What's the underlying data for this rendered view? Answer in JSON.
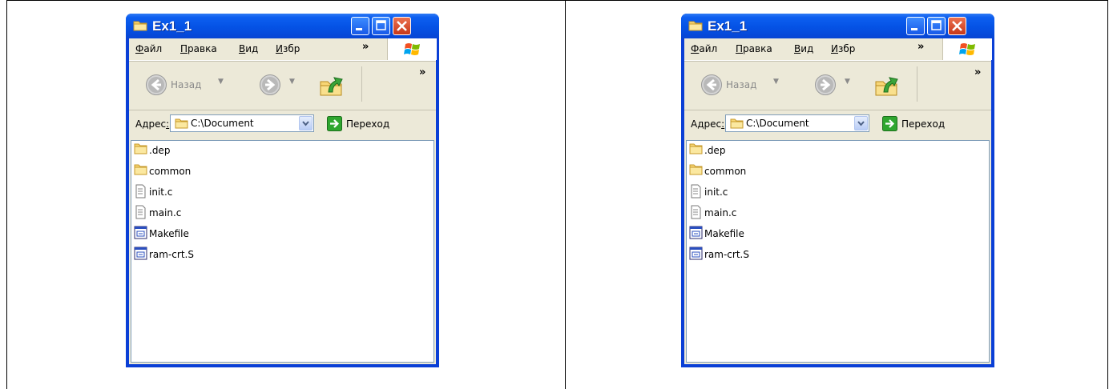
{
  "windows": [
    {
      "title": "Ex1_1",
      "menu": [
        {
          "label": "Файл",
          "accel": "Ф",
          "rest": "айл"
        },
        {
          "label": "Правка",
          "accel": "П",
          "rest": "равка"
        },
        {
          "label": "Вид",
          "accel": "В",
          "rest": "ид"
        },
        {
          "label": "Избр",
          "accel": "И",
          "rest": "збр"
        }
      ],
      "menu_overflow": "»",
      "toolbar": {
        "back_label": "Назад",
        "overflow": "»"
      },
      "address": {
        "label_main": "Адрес",
        "label_accel": ":",
        "value": "C:\\Document",
        "go_label": "Переход"
      },
      "files": [
        {
          "name": ".dep",
          "icon": "folder-icon"
        },
        {
          "name": "common",
          "icon": "folder-icon"
        },
        {
          "name": "init.c",
          "icon": "text-file-icon"
        },
        {
          "name": "main.c",
          "icon": "text-file-icon"
        },
        {
          "name": "Makefile",
          "icon": "app-file-icon"
        },
        {
          "name": "ram-crt.S",
          "icon": "app-file-icon"
        }
      ]
    },
    {
      "title": "Ex1_1",
      "menu": [
        {
          "label": "Файл",
          "accel": "Ф",
          "rest": "айл"
        },
        {
          "label": "Правка",
          "accel": "П",
          "rest": "равка"
        },
        {
          "label": "Вид",
          "accel": "В",
          "rest": "ид"
        },
        {
          "label": "Избр",
          "accel": "И",
          "rest": "збр"
        }
      ],
      "menu_overflow": "»",
      "toolbar": {
        "back_label": "Назад",
        "overflow": "»"
      },
      "address": {
        "label_main": "Адрес",
        "label_accel": ":",
        "value": "C:\\Document",
        "go_label": "Переход"
      },
      "files": [
        {
          "name": ".dep",
          "icon": "folder-icon"
        },
        {
          "name": "common",
          "icon": "folder-icon"
        },
        {
          "name": "init.c",
          "icon": "text-file-icon"
        },
        {
          "name": "main.c",
          "icon": "text-file-icon"
        },
        {
          "name": "Makefile",
          "icon": "app-file-icon"
        },
        {
          "name": "ram-crt.S",
          "icon": "app-file-icon"
        }
      ]
    }
  ],
  "colors": {
    "xp_blue": "#0a3fd6",
    "xp_face": "#ece9d8",
    "border": "#7f9db9"
  }
}
